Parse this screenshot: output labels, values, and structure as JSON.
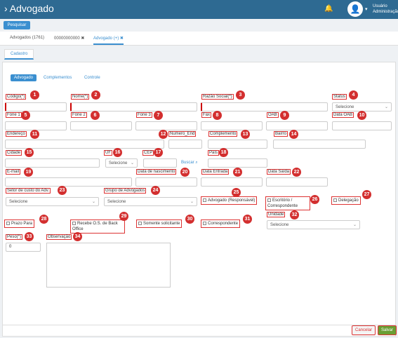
{
  "header": {
    "title": "Advogado",
    "user_line1": "Usuário",
    "user_line2": "Administração"
  },
  "toolbar": {
    "search_label": "Pesquisar"
  },
  "tabs": [
    {
      "label": "Advogados (1761)"
    },
    {
      "label": "00000000000"
    },
    {
      "label": "Advogado (+)"
    }
  ],
  "section_tab": "Cadastro",
  "sub_tabs": [
    "Advogado",
    "Complementos",
    "Controle"
  ],
  "fields": {
    "codigo": "Código(*)",
    "nome": "Nome(*)",
    "razao": "Razão Social(*)",
    "status": "Status",
    "fone1": "Fone 1",
    "fone2": "Fone 2",
    "fone3": "Fone 3",
    "fax": "Fax",
    "oab": "OAB",
    "data_oab": "Data OAB",
    "endereco": "Endereço",
    "numero": "Numero_End",
    "complemento": "Complemento",
    "bairro": "Bairro",
    "cidade": "Cidade",
    "uf": "UF",
    "cep": "CEP",
    "pais": "País",
    "email": "E-mail",
    "data_nasc": "Data de nascimento",
    "data_entrada": "Data Entrada",
    "data_saida": "Data Saída",
    "setor": "Setor de custo do Adv.",
    "grupo": "Grupo de Advogados",
    "unidade": "Unidade",
    "peso": "Peso(*)",
    "observacao": "Observação"
  },
  "selects": {
    "status": "Selecione",
    "uf": "Selecione",
    "setor": "Selecione",
    "grupo": "Selecione",
    "unidade": "Selecione"
  },
  "checkboxes": {
    "adv_resp": "Advogado (Responsável)",
    "escritorio": "Escritório / Correspondente",
    "delegacao": "Delegação",
    "prazo": "Prazo Para",
    "recebe": "Recebe O.S. de Back Office",
    "somente": "Somente solicitante",
    "correspondente": "Correspondente"
  },
  "buscar": "Buscar",
  "peso_value": "0",
  "buttons": {
    "cancel": "Cancelar",
    "save": "Salvar"
  },
  "badges": [
    "1",
    "2",
    "3",
    "4",
    "5",
    "6",
    "7",
    "8",
    "9",
    "10",
    "11",
    "12",
    "13",
    "14",
    "15",
    "16",
    "17",
    "18",
    "19",
    "20",
    "21",
    "22",
    "23",
    "24",
    "25",
    "26",
    "27",
    "28",
    "29",
    "30",
    "31",
    "32",
    "33",
    "34"
  ]
}
